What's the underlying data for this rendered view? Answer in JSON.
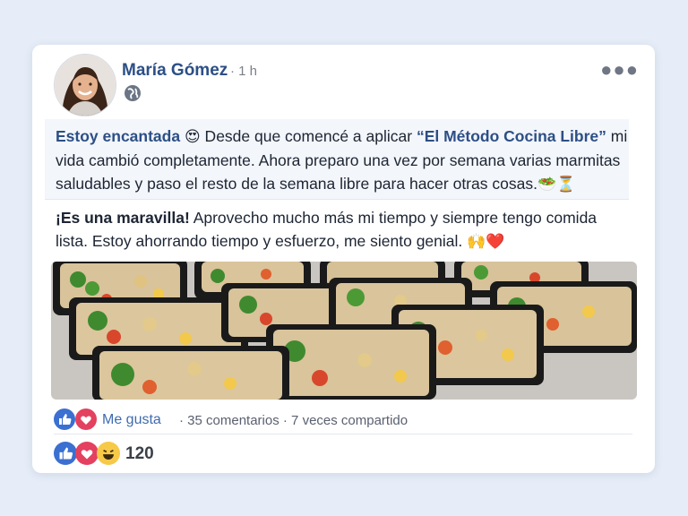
{
  "post": {
    "author": "María Gómez",
    "time": "· 1 h",
    "paragraph1": {
      "highlight": "Estoy encantada",
      "emoji1": "😍",
      "text1": " Desde que comencé a aplicar ",
      "method": "“El Método Cocina Libre”",
      "text2": " mi vida cambió completamente. Ahora preparo una vez por semana varias marmitas saludables y paso el resto de la semana libre para hacer otras cosas.",
      "emoji2": "🥗⏳"
    },
    "paragraph2": {
      "bold": "¡Es una maravilla!",
      "text": " Aprovecho mucho más mi tiempo y siempre tengo comida lista. Estoy ahorrando tiempo y esfuerzo, me siento genial.",
      "emoji": "🙌❤️"
    }
  },
  "stats": {
    "like_label": "Me gusta",
    "comments": "· 35 comentarios",
    "shares": "· 7 veces compartido"
  },
  "reactions": {
    "count": "120"
  },
  "icons": [
    "globe-icon",
    "more-icon",
    "like-icon",
    "heart-icon",
    "haha-icon"
  ],
  "colors": {
    "accent": "#2c4f86",
    "like": "#3b6fd1",
    "heart": "#e4405f",
    "haha": "#f7c948"
  }
}
